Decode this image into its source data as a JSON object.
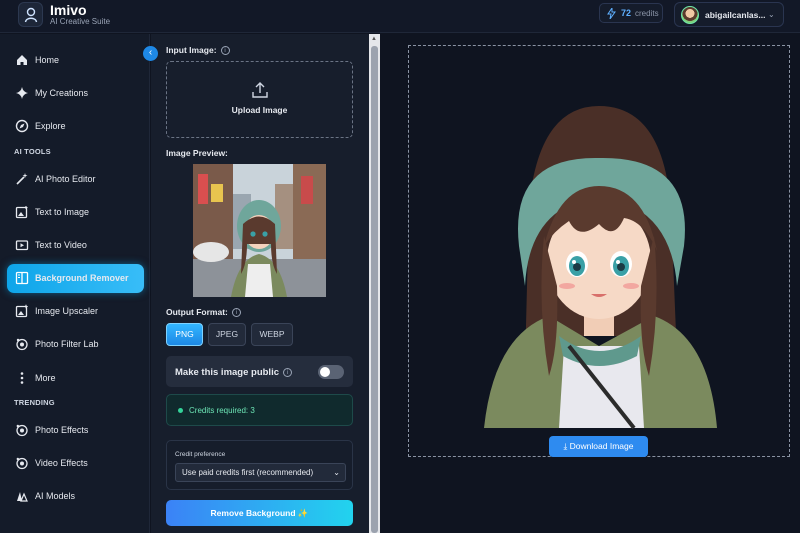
{
  "app": {
    "name": "Imivo",
    "tagline": "AI Creative Suite"
  },
  "header": {
    "credits_count": "72",
    "credits_label": "credits",
    "username": "abigailcanlas..."
  },
  "sidebar": {
    "items_top": [
      {
        "label": "Home",
        "icon": "home-icon"
      },
      {
        "label": "My Creations",
        "icon": "sparkle-icon"
      },
      {
        "label": "Explore",
        "icon": "compass-icon"
      }
    ],
    "section_ai_tools": "AI TOOLS",
    "items_tools": [
      {
        "label": "AI Photo Editor",
        "icon": "magic-wand-icon"
      },
      {
        "label": "Text to Image",
        "icon": "image-icon"
      },
      {
        "label": "Text to Video",
        "icon": "video-icon"
      },
      {
        "label": "Background Remover",
        "icon": "split-square-icon",
        "active": true
      },
      {
        "label": "Image Upscaler",
        "icon": "upscale-icon"
      },
      {
        "label": "Photo Filter Lab",
        "icon": "filter-icon"
      },
      {
        "label": "More",
        "icon": "more-vertical-icon"
      }
    ],
    "section_trending": "TRENDING",
    "items_trending": [
      {
        "label": "Photo Effects",
        "icon": "photo-effects-icon"
      },
      {
        "label": "Video Effects",
        "icon": "video-effects-icon"
      },
      {
        "label": "AI Models",
        "icon": "models-icon"
      }
    ]
  },
  "panel": {
    "input_label": "Input Image:",
    "upload_label": "Upload Image",
    "preview_label": "Image Preview:",
    "output_label": "Output Format:",
    "formats": [
      "PNG",
      "JPEG",
      "WEBP"
    ],
    "selected_format": "PNG",
    "public_label": "Make this image public",
    "public_enabled": false,
    "credits_required": "Credits required: 3",
    "credit_pref_label": "Credit preference",
    "credit_pref_value": "Use paid credits first (recommended)",
    "remove_button": "Remove Background ✨"
  },
  "result": {
    "download_label": "Download Image"
  },
  "colors": {
    "accent": "#0ea5e9",
    "background": "#0f1420",
    "success": "#34d399"
  }
}
